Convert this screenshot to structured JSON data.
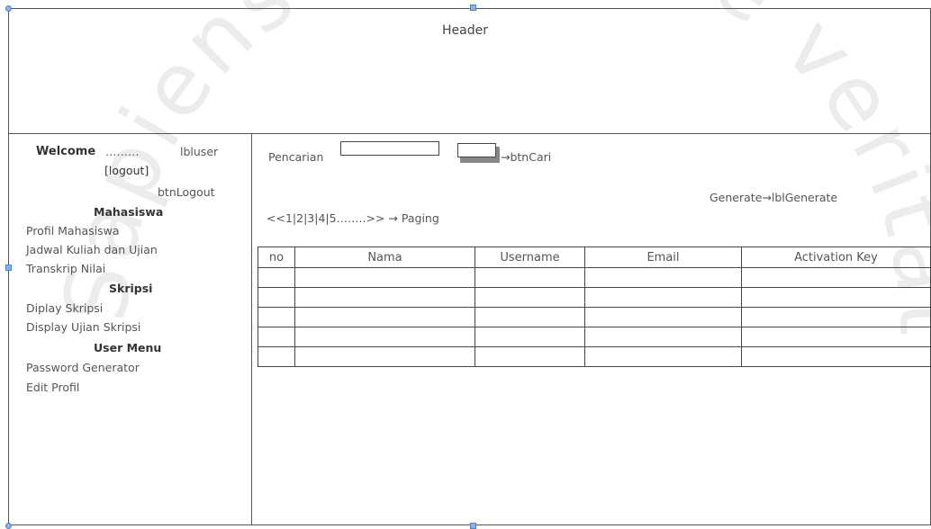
{
  "header": {
    "title": "Header"
  },
  "sidebar": {
    "welcome": "Welcome",
    "welcome_dots": "………",
    "lbl_user": "lbluser",
    "logout": "[logout]",
    "btn_logout": "btnLogout",
    "sections": [
      {
        "title": "Mahasiswa",
        "items": [
          "Profil Mahasiswa",
          "Jadwal Kuliah dan Ujian",
          "Transkrip Nilai"
        ]
      },
      {
        "title": "Skripsi",
        "items": [
          "Diplay Skripsi",
          "Display Ujian Skripsi"
        ]
      },
      {
        "title": "User Menu",
        "items": [
          "Password Generator",
          "Edit Profil"
        ]
      }
    ]
  },
  "main": {
    "search_label": "Pencarian",
    "btn_cari": "→btnCari",
    "generate": "Generate→lblGenerate",
    "paging": "<<1|2|3|4|5……..>>  →  Paging",
    "table": {
      "columns": [
        "no",
        "Nama",
        "Username",
        "Email",
        "Activation Key"
      ],
      "rows": [
        [
          "",
          "",
          "",
          "",
          ""
        ],
        [
          "",
          "",
          "",
          "",
          ""
        ],
        [
          "",
          "",
          "",
          "",
          ""
        ],
        [
          "",
          "",
          "",
          "",
          ""
        ],
        [
          "",
          "",
          "",
          "",
          ""
        ]
      ]
    }
  },
  "watermark": {
    "text": "Sapiens in lumine veritatis",
    "color": "#e8e8e8"
  }
}
